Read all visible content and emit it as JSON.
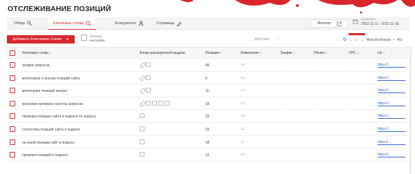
{
  "page": {
    "title": "ОТСЛЕЖИВАНИЕ ПОЗИЦИЙ"
  },
  "tabs": [
    {
      "label": "Обзор",
      "icon": "chart-icon"
    },
    {
      "label": "Ключевые слова",
      "icon": "search-icon",
      "active": true
    },
    {
      "label": "Конкуренты",
      "icon": "person-icon"
    },
    {
      "label": "Страницы",
      "icon": "pen-icon"
    }
  ],
  "export": {
    "label": "Экспорт",
    "icon": "external-link-icon"
  },
  "compare": {
    "label": "Сравнить",
    "dates": "2022-11-11 - 2022-11-18"
  },
  "toolbar": {
    "add_label": "Добавить Ключевые Слова",
    "add_icon": "plus-icon",
    "table_label": "Таблица",
    "settings_label": "Настройки",
    "actions_label": "Действия"
  },
  "location": {
    "engine": "G",
    "device": "desktop-icon",
    "region": "Moscow,Russia",
    "lang": "RU"
  },
  "table": {
    "columns": {
      "keyword": "Ключевое слово ↕",
      "serp": "Блоки расширенной выдачи",
      "position": "Позиция ↕",
      "change": "Изменение ↕",
      "traffic": "Трафик ↕",
      "volume": "Объём ↕",
      "cpc": "CPC ↕",
      "url": "Url ↕"
    },
    "rows": [
      {
        "keyword": "трафик запросов",
        "position": "66",
        "change": "34 ↑",
        "traffic": "-",
        "volume": "-",
        "cpc": "-",
        "url": "https://..."
      },
      {
        "keyword": "мониторинг и анализ позиций сайта",
        "position": "5",
        "change": "26 ↑",
        "traffic": "-",
        "volume": "-",
        "cpc": "-",
        "url": "https://..."
      },
      {
        "keyword": "мониторинг позиций анализ",
        "position": "11",
        "change": "24 ↑",
        "traffic": "-",
        "volume": "-",
        "cpc": "-",
        "url": "https://..."
      },
      {
        "keyword": "массовая проверка частоты запросов",
        "position": "33",
        "change": "21 ↑",
        "traffic": "-",
        "volume": "-",
        "cpc": "-",
        "url": "https://..."
      },
      {
        "keyword": "проверка позиции сайта в яндексе по запросу",
        "position": "23",
        "change": "19 ↑",
        "traffic": "-",
        "volume": "-",
        "cpc": "-",
        "url": "https://..."
      },
      {
        "keyword": "статистика позиций сайта в яндексе",
        "position": "23",
        "change": "12 ↑",
        "traffic": "-",
        "volume": "-",
        "cpc": "-",
        "url": "https://..."
      },
      {
        "keyword": "на какой позиции сайт в яндексе",
        "position": "18",
        "change": "11 ↑",
        "traffic": "-",
        "volume": "-",
        "cpc": "-",
        "url": "https://..."
      },
      {
        "keyword": "проверка позиций в яндексе",
        "position": "12",
        "change": "10 ↑",
        "traffic": "-",
        "volume": "-",
        "cpc": "-",
        "url": "https://..."
      }
    ]
  },
  "colors": {
    "accent": "#d9262c",
    "link": "#3366cc"
  }
}
